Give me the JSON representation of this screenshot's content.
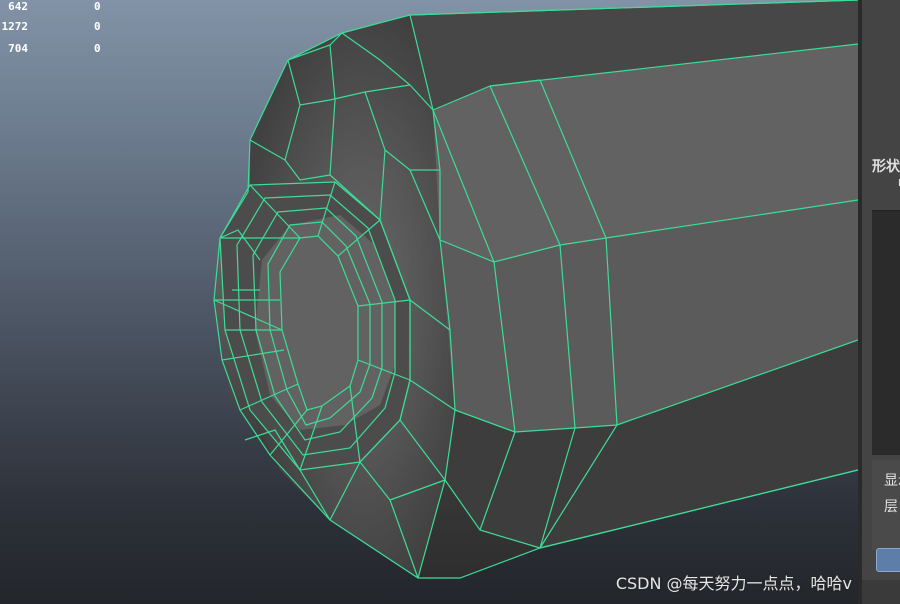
{
  "hud": {
    "rows": [
      {
        "value_a": "642",
        "value_b": "0"
      },
      {
        "value_a": "1272",
        "value_b": "0"
      },
      {
        "value_a": "704",
        "value_b": "0"
      }
    ]
  },
  "attribute_panel": {
    "section_label": "形状",
    "section_sublabel": "I",
    "display_label": "显示",
    "layer_label": "层"
  },
  "watermark": "CSDN @每天努力一点点，哈哈v",
  "colors": {
    "wireframe": "#3ddc97",
    "viewport_top": "#8293a7",
    "viewport_bottom": "#23262b",
    "panel_bg": "#444444",
    "panel_button": "#5d7ea8"
  }
}
